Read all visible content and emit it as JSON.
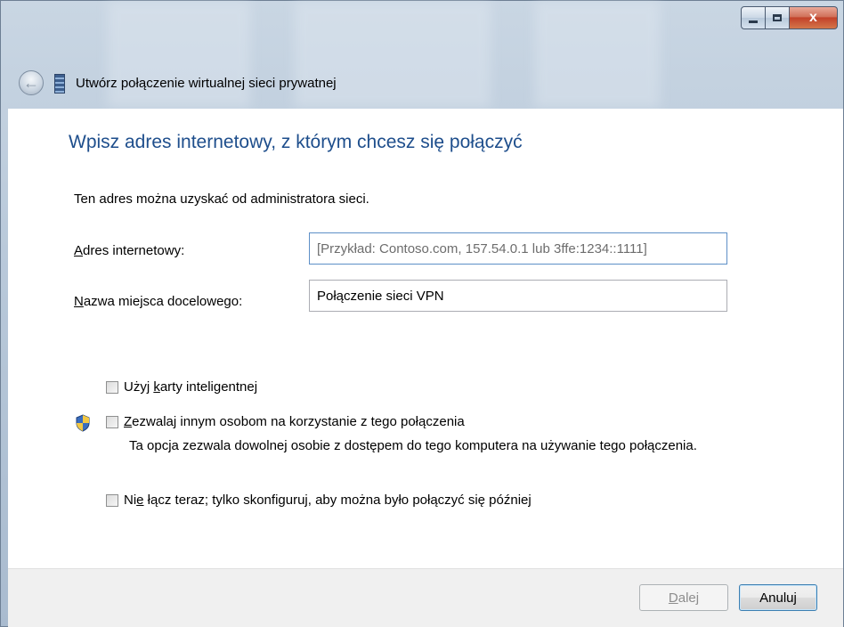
{
  "window": {
    "title": "Utwórz połączenie wirtualnej sieci prywatnej",
    "buttons": {
      "minimize": "minimize",
      "maximize": "maximize",
      "close": "x"
    }
  },
  "page": {
    "heading": "Wpisz adres internetowy, z którym chcesz się połączyć",
    "intro": "Ten adres można uzyskać od administratora sieci."
  },
  "form": {
    "address_label_key": "A",
    "address_label_rest": "dres internetowy:",
    "address_placeholder": "[Przykład: Contoso.com, 157.54.0.1 lub 3ffe:1234::1111]",
    "address_value": "",
    "name_label_key": "N",
    "name_label_rest": "azwa miejsca docelowego:",
    "name_value": "Połączenie sieci VPN"
  },
  "options": {
    "smartcard_pre": "Użyj ",
    "smartcard_key": "k",
    "smartcard_post": "arty inteligentnej",
    "allow_key": "Z",
    "allow_post": "ezwalaj innym osobom na korzystanie z tego połączenia",
    "allow_desc": "Ta opcja zezwala dowolnej osobie z dostępem do tego komputera na używanie tego połączenia.",
    "noconnect_pre": "Ni",
    "noconnect_key": "e",
    "noconnect_post": " łącz teraz; tylko skonfiguruj, aby można było połączyć się później",
    "smartcard_checked": false,
    "allow_checked": false,
    "noconnect_checked": false
  },
  "footer": {
    "next_key": "D",
    "next_rest": "alej",
    "cancel": "Anuluj"
  },
  "icons": {
    "back": "back-arrow-icon",
    "vpn": "network-connection-icon",
    "shield": "uac-shield-icon"
  }
}
